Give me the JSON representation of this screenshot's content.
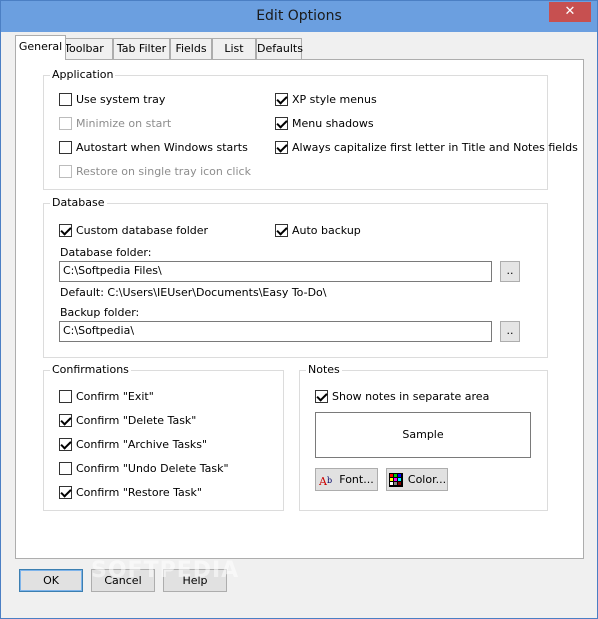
{
  "window": {
    "title": "Edit Options",
    "close_glyph": "✕"
  },
  "tabs": [
    {
      "label": "General",
      "active": true
    },
    {
      "label": "Toolbar"
    },
    {
      "label": "Tab Filter"
    },
    {
      "label": "Fields"
    },
    {
      "label": "List"
    },
    {
      "label": "Defaults"
    }
  ],
  "application": {
    "title": "Application",
    "items": [
      {
        "label": "Use system tray",
        "checked": false,
        "enabled": true
      },
      {
        "label": "Minimize on start",
        "checked": false,
        "enabled": false
      },
      {
        "label": "Autostart when Windows starts",
        "checked": false,
        "enabled": true
      },
      {
        "label": "Restore on single tray icon click",
        "checked": false,
        "enabled": false
      },
      {
        "label": "XP style menus",
        "checked": true,
        "enabled": true
      },
      {
        "label": "Menu shadows",
        "checked": true,
        "enabled": true
      },
      {
        "label": "Always capitalize first letter in Title and Notes fields",
        "checked": true,
        "enabled": true
      }
    ]
  },
  "database": {
    "title": "Database",
    "custom_folder": {
      "label": "Custom database folder",
      "checked": true
    },
    "auto_backup": {
      "label": "Auto backup",
      "checked": true
    },
    "db_folder_label": "Database folder:",
    "db_folder_value": "C:\\Softpedia Files\\",
    "browse_label": "..",
    "default_text": "Default: C:\\Users\\IEUser\\Documents\\Easy To-Do\\",
    "backup_folder_label": "Backup folder:",
    "backup_folder_value": "C:\\Softpedia\\"
  },
  "confirmations": {
    "title": "Confirmations",
    "items": [
      {
        "label": "Confirm \"Exit\"",
        "checked": false
      },
      {
        "label": "Confirm \"Delete Task\"",
        "checked": true
      },
      {
        "label": "Confirm \"Archive Tasks\"",
        "checked": true
      },
      {
        "label": "Confirm \"Undo Delete Task\"",
        "checked": false
      },
      {
        "label": "Confirm \"Restore Task\"",
        "checked": true
      }
    ]
  },
  "notes": {
    "title": "Notes",
    "show_separate": {
      "label": "Show notes in separate area",
      "checked": true
    },
    "sample_text": "Sample",
    "font_button": "Font...",
    "color_button": "Color..."
  },
  "buttons": {
    "ok": "OK",
    "cancel": "Cancel",
    "help": "Help"
  },
  "watermark": "SOFTPEDIA",
  "colors": {
    "titlebar": "#6b9fe0",
    "close": "#c75050",
    "accent_border": "#3c7fb1"
  }
}
